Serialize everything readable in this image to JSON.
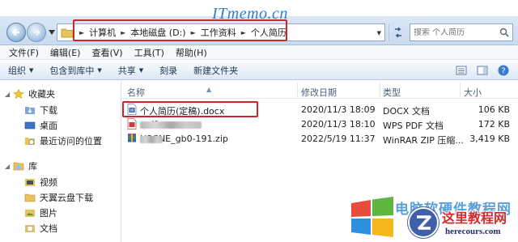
{
  "watermark": "ITmemo.cn",
  "breadcrumbs": [
    "计算机",
    "本地磁盘 (D:)",
    "工作资料",
    "个人简历"
  ],
  "search": {
    "placeholder": "搜索 个人简历"
  },
  "menu": [
    "文件(F)",
    "编辑(E)",
    "查看(V)",
    "工具(T)",
    "帮助(H)"
  ],
  "commands": [
    "组织",
    "包含到库中",
    "共享",
    "刻录",
    "新建文件夹"
  ],
  "nav": {
    "favorites_label": "收藏夹",
    "favorites": [
      "下载",
      "桌面",
      "最近访问的位置"
    ],
    "library_label": "库",
    "library": [
      "视频",
      "天翼云盘下载",
      "图片",
      "文档"
    ]
  },
  "columns": {
    "name": "名称",
    "date": "修改日期",
    "type": "类型",
    "size": "大小"
  },
  "files": [
    {
      "name": "个人简历(定稿).docx",
      "date": "2020/11/3 18:09",
      "type": "DOCX 文档",
      "size": "106 KB",
      "icon": "docx-icon"
    },
    {
      "name": ".pdf",
      "date": "2020/11/3 18:10",
      "type": "WPS PDF 文档",
      "size": "172 KB",
      "icon": "pdf-icon"
    },
    {
      "name": "H3CNE_gb0-191.zip",
      "date": "2022/5/19 11:37",
      "type": "WinRAR ZIP 压缩...",
      "size": "3,419 KB",
      "icon": "zip-icon"
    }
  ],
  "logos": {
    "bg_text": "电脑软硬件教程网",
    "badge_title": "这里教程网",
    "badge_sub": "herecours.com"
  },
  "colors": {
    "highlight": "#d0252f",
    "accent": "#2f7fd0"
  }
}
